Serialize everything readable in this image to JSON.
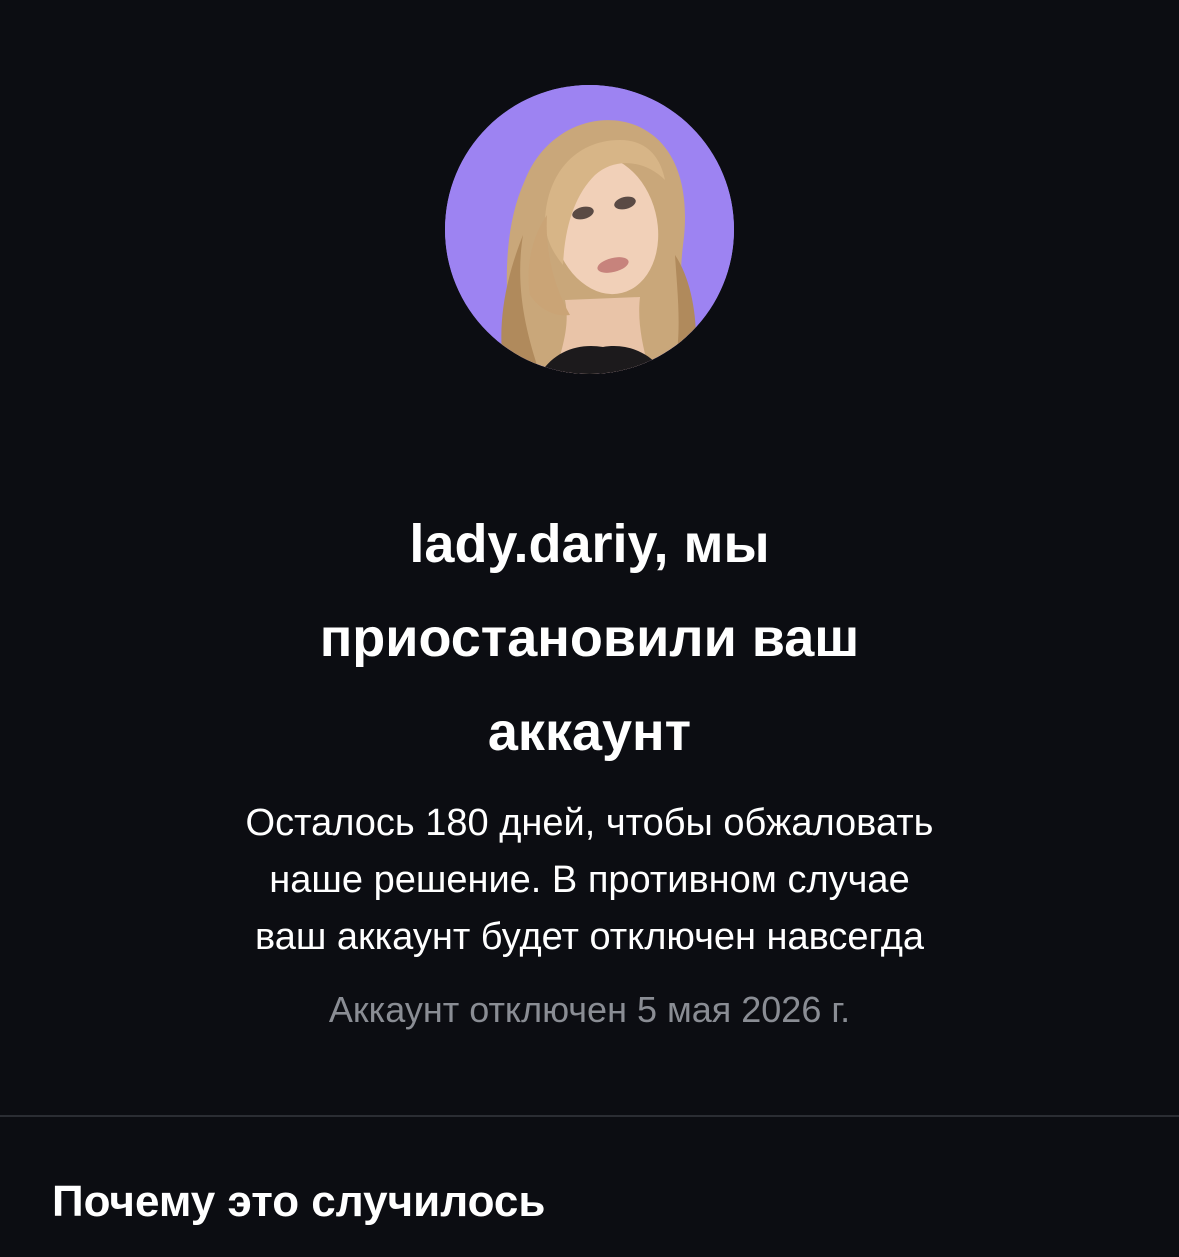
{
  "profile": {
    "avatar_description": "profile-photo",
    "avatar_bg": "#9d83f2"
  },
  "notice": {
    "headline_lines": [
      "lady.dariy, мы",
      "приостановили ваш",
      "аккаунт"
    ],
    "body_lines": [
      "Осталось 180 дней, чтобы обжаловать",
      "наше решение. В противном случае",
      "ваш аккаунт будет отключен навсегда"
    ],
    "disabled_date": "Аккаунт отключен 5 мая 2026 г."
  },
  "section": {
    "title": "Почему это случилось"
  },
  "colors": {
    "background": "#0c0d12",
    "text_primary": "#ffffff",
    "text_secondary": "#8a8d94",
    "divider": "#2b2d33"
  }
}
